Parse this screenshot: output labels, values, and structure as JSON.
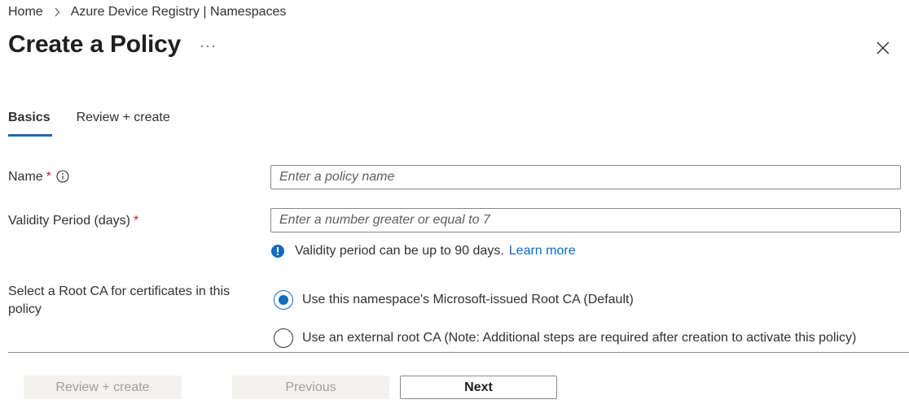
{
  "breadcrumb": {
    "items": [
      "Home",
      "Azure Device Registry | Namespaces"
    ]
  },
  "header": {
    "title": "Create a Policy",
    "more_label": "···"
  },
  "tabs": [
    {
      "label": "Basics",
      "active": true
    },
    {
      "label": "Review + create",
      "active": false
    }
  ],
  "form": {
    "name": {
      "label": "Name",
      "required_mark": "*",
      "value": "",
      "placeholder": "Enter a policy name"
    },
    "validity": {
      "label": "Validity Period (days)",
      "required_mark": "*",
      "value": "",
      "placeholder": "Enter a number greater or equal to 7",
      "info_text": "Validity period can be up to 90 days.",
      "info_link": "Learn more"
    },
    "root_ca": {
      "label": "Select a Root CA for certificates in this policy",
      "options": [
        {
          "label": "Use this namespace's Microsoft-issued Root CA (Default)",
          "selected": true
        },
        {
          "label": "Use an external root CA (Note: Additional steps are required after creation to activate this policy)",
          "selected": false
        }
      ]
    }
  },
  "footer": {
    "review_create_label": "Review + create",
    "previous_label": "Previous",
    "next_label": "Next"
  },
  "colors": {
    "accent": "#0f6cbd",
    "required": "#a4262c",
    "text": "#323130",
    "disabled_bg": "#f3f2f1",
    "disabled_text": "#a19f9d"
  }
}
